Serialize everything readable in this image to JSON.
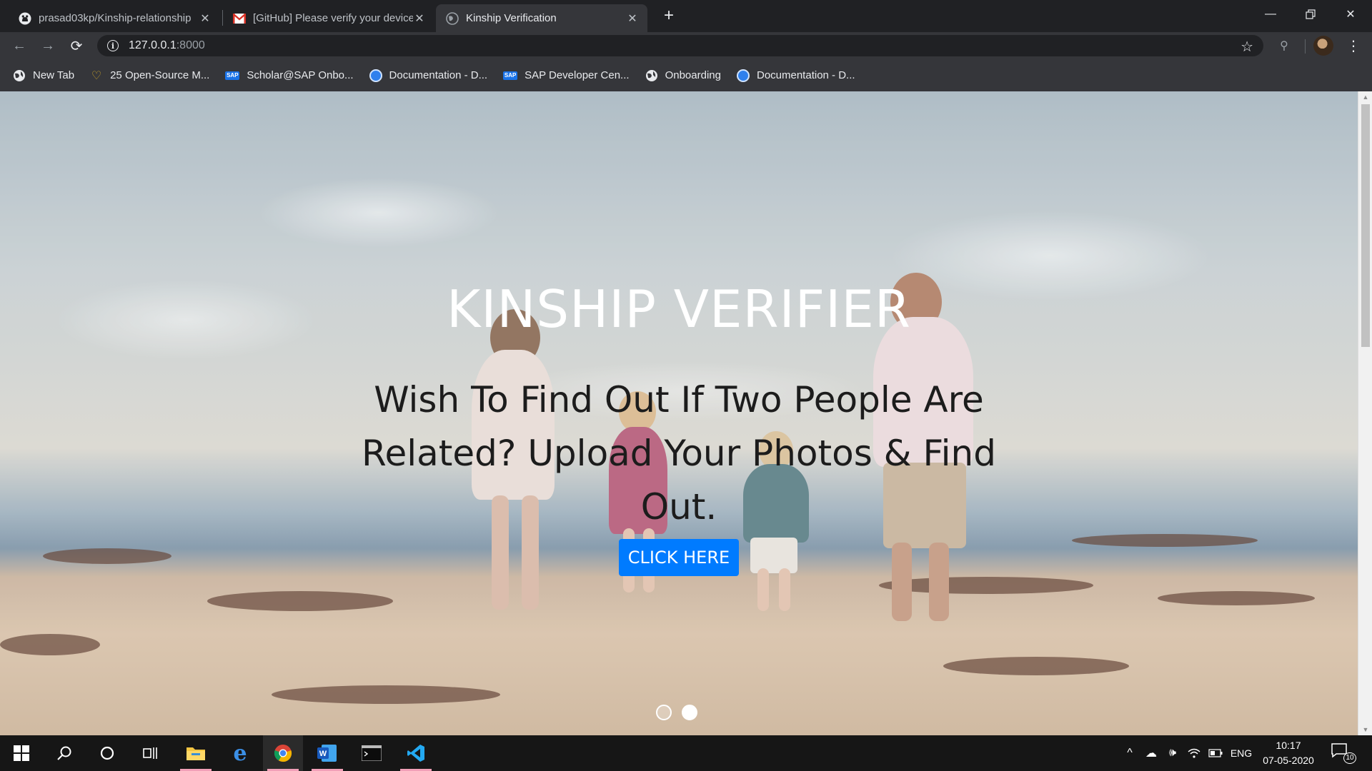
{
  "browser": {
    "tabs": [
      {
        "label": "prasad03kp/Kinship-relationship",
        "icon": "github-icon",
        "active": false
      },
      {
        "label": "[GitHub] Please verify your device",
        "icon": "gmail-icon",
        "active": false
      },
      {
        "label": "Kinship Verification",
        "icon": "globe-icon",
        "active": true
      }
    ],
    "url_host": "127.0.0.1",
    "url_port": ":8000"
  },
  "bookmarks": [
    {
      "label": "New Tab",
      "icon": "globe-icon"
    },
    {
      "label": "25 Open-Source M...",
      "icon": "heart-icon"
    },
    {
      "label": "Scholar@SAP Onbo...",
      "icon": "sap-icon"
    },
    {
      "label": "Documentation - D...",
      "icon": "doc-globe-icon"
    },
    {
      "label": "SAP Developer Cen...",
      "icon": "sap-icon"
    },
    {
      "label": "Onboarding",
      "icon": "globe-icon"
    },
    {
      "label": "Documentation - D...",
      "icon": "doc-globe-icon"
    }
  ],
  "hero": {
    "title": "KINSHIP VERIFIER",
    "subtitle": "Wish To Find Out If Two People Are Related? Upload Your Photos & Find Out.",
    "button_label": "CLICK HERE",
    "slides": 2,
    "active_slide": 1
  },
  "taskbar": {
    "language": "ENG",
    "time": "10:17",
    "date": "07-05-2020",
    "notifications": "10"
  },
  "colors": {
    "accent": "#007bff",
    "chrome_dark": "#202124",
    "chrome_toolbar": "#35363a"
  }
}
